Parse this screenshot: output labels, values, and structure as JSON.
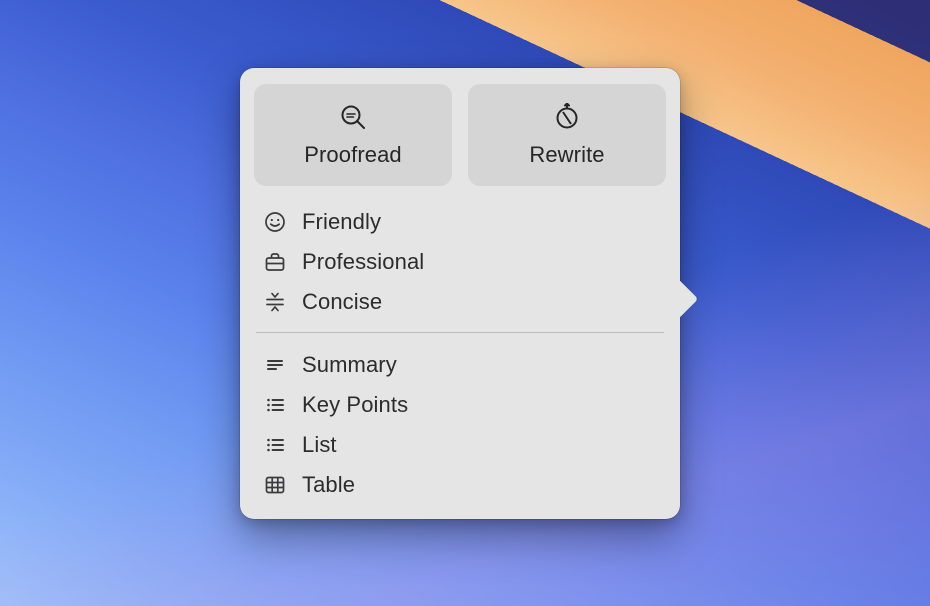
{
  "popover": {
    "primary_actions": {
      "proofread": {
        "label": "Proofread"
      },
      "rewrite": {
        "label": "Rewrite"
      }
    },
    "tone_items": [
      {
        "label": "Friendly"
      },
      {
        "label": "Professional"
      },
      {
        "label": "Concise"
      }
    ],
    "format_items": [
      {
        "label": "Summary"
      },
      {
        "label": "Key Points"
      },
      {
        "label": "List"
      },
      {
        "label": "Table"
      }
    ]
  }
}
